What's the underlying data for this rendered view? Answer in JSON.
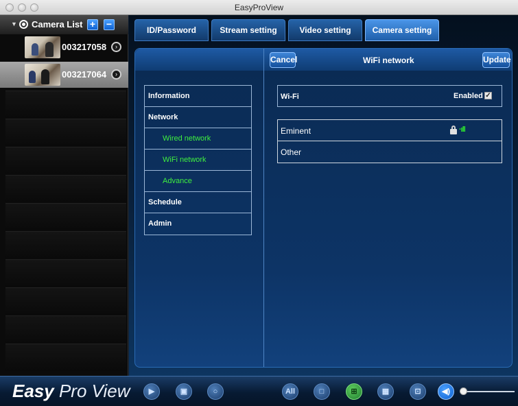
{
  "window": {
    "title": "EasyProView"
  },
  "camera_list": {
    "title": "Camera List",
    "add_label": "+",
    "remove_label": "−",
    "cameras": [
      {
        "id": "003217058",
        "selected": false
      },
      {
        "id": "003217064",
        "selected": true
      }
    ]
  },
  "tabs": [
    {
      "label": "ID/Password",
      "active": false
    },
    {
      "label": "Stream setting",
      "active": false
    },
    {
      "label": "Video setting",
      "active": false
    },
    {
      "label": "Camera setting",
      "active": true
    }
  ],
  "panel": {
    "cancel_label": "Cancel",
    "title": "WiFi network",
    "update_label": "Update"
  },
  "menu": [
    {
      "label": "Information",
      "sub": false
    },
    {
      "label": "Network",
      "sub": false
    },
    {
      "label": "Wired network",
      "sub": true
    },
    {
      "label": "WiFi network",
      "sub": true
    },
    {
      "label": "Advance",
      "sub": true
    },
    {
      "label": "Schedule",
      "sub": false
    },
    {
      "label": "Admin",
      "sub": false
    }
  ],
  "wifi": {
    "label": "Wi-Fi",
    "enabled_label": "Enabled",
    "enabled": true
  },
  "networks": [
    {
      "name": "Eminent",
      "locked": true,
      "signal_icon": "signal-icon"
    },
    {
      "name": "Other",
      "locked": false
    }
  ],
  "bottom": {
    "brand_bold": "Easy",
    "brand_light": "Pro View",
    "all_label": "All"
  },
  "colors": {
    "accent_blue": "#1f5faa",
    "submenu_green": "#3ff03f"
  }
}
